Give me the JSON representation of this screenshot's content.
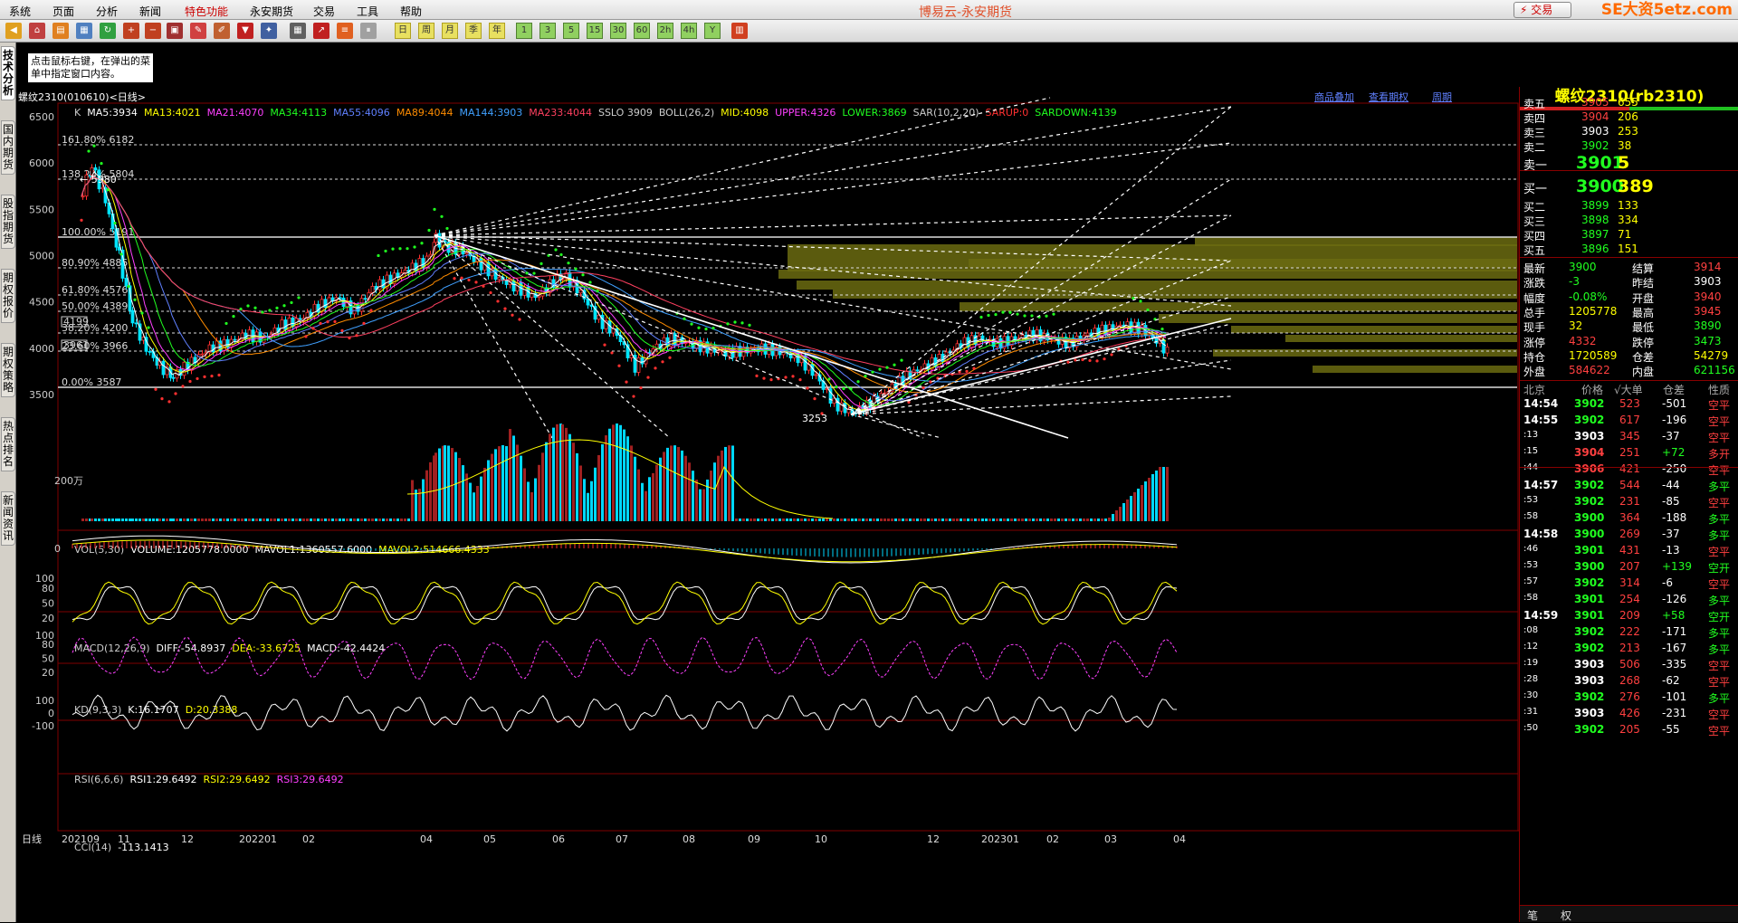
{
  "menu": {
    "items": [
      "系统",
      "页面",
      "分析",
      "新闻",
      "特色功能",
      "永安期货",
      "交易",
      "工具",
      "帮助"
    ],
    "app_title": "博易云-永安期货",
    "trade_button": "⚡ 交易",
    "watermark": "SE大资5etz.com"
  },
  "toolbar": {
    "period_buttons": [
      "日",
      "周",
      "月",
      "季",
      "年",
      "1",
      "3",
      "5",
      "15",
      "30",
      "60",
      "2h",
      "4h",
      "Y"
    ]
  },
  "left_tabs": [
    "技术分析",
    "国内期货",
    "股指期货",
    "期权报价",
    "期权策略",
    "热点排名",
    "新闻资讯"
  ],
  "tooltip": "点击鼠标右键，在弹出的菜单中指定窗口内容。",
  "chart": {
    "header": "螺纹2310(010610)<日线>",
    "links": [
      "商品叠加",
      "查看期权",
      "周期"
    ],
    "indicator_line": [
      {
        "t": "K",
        "c": "#ccc"
      },
      {
        "t": "MA5:3934",
        "c": "#fff"
      },
      {
        "t": "MA13:4021",
        "c": "#ffff00"
      },
      {
        "t": "MA21:4070",
        "c": "#ff40ff"
      },
      {
        "t": "MA34:4113",
        "c": "#20ff20"
      },
      {
        "t": "MA55:4096",
        "c": "#6080ff"
      },
      {
        "t": "MA89:4044",
        "c": "#ff8c00"
      },
      {
        "t": "MA144:3903",
        "c": "#40a0ff"
      },
      {
        "t": "MA233:4044",
        "c": "#ff4060"
      },
      {
        "t": "SSLO 3909",
        "c": "#ccc"
      },
      {
        "t": "BOLL(26,2)",
        "c": "#ccc"
      },
      {
        "t": "MID:4098",
        "c": "#ffff00"
      },
      {
        "t": "UPPER:4326",
        "c": "#ff40ff"
      },
      {
        "t": "LOWER:3869",
        "c": "#20ff20"
      },
      {
        "t": "SAR(10,2,20)",
        "c": "#ccc"
      },
      {
        "t": "SARUP:0",
        "c": "#ff3030"
      },
      {
        "t": "SARDOWN:4139",
        "c": "#20ff20"
      }
    ],
    "y_ticks": [
      "6500",
      "6000",
      "5500",
      "5000",
      "4500",
      "4000",
      "3500"
    ],
    "fib_labels": [
      "161.80% 6182",
      "138.20% 5804",
      "100.00% 5191",
      "80.90% 4885",
      "61.80% 4576",
      "50.00% 4389",
      "38.20% 4200",
      "23.60% 3966",
      "0.00% 3587"
    ],
    "price_marks": {
      "high": "5980",
      "low": "3253",
      "box1": "4199",
      "box2": "3961"
    },
    "vol_title": [
      {
        "t": "VOL(5,30)",
        "c": "#ccc"
      },
      {
        "t": "VOLUME:1205778.0000",
        "c": "#fff"
      },
      {
        "t": "MAVOL1:1360557.6000",
        "c": "#fff"
      },
      {
        "t": "MAVOL2:514666.4333",
        "c": "#ffff00"
      }
    ],
    "vol_tick": "200万",
    "macd_title": [
      {
        "t": "MACD(12,26,9)",
        "c": "#ccc"
      },
      {
        "t": "DIFF:-54.8937",
        "c": "#fff"
      },
      {
        "t": "DEA:-33.6725",
        "c": "#ffff00"
      },
      {
        "t": "MACD:-42.4424",
        "c": "#fff"
      }
    ],
    "macd_tick": "0",
    "kd_title": [
      {
        "t": "KD(9,3,3)",
        "c": "#ccc"
      },
      {
        "t": "K:16.1707",
        "c": "#fff"
      },
      {
        "t": "D:20.3388",
        "c": "#ffff00"
      }
    ],
    "kd_ticks": [
      "100",
      "80",
      "50",
      "20"
    ],
    "rsi_title": [
      {
        "t": "RSI(6,6,6)",
        "c": "#ccc"
      },
      {
        "t": "RSI1:29.6492",
        "c": "#fff"
      },
      {
        "t": "RSI2:29.6492",
        "c": "#ffff00"
      },
      {
        "t": "RSI3:29.6492",
        "c": "#ff40ff"
      }
    ],
    "rsi_ticks": [
      "100",
      "80",
      "50",
      "20"
    ],
    "cci_title": [
      {
        "t": "CCI(14)",
        "c": "#ccc"
      },
      {
        "t": "-113.1413",
        "c": "#fff"
      }
    ],
    "cci_ticks": [
      "100",
      "0",
      "-100"
    ],
    "x_labels": [
      "日线",
      "202109",
      "11",
      "12",
      "202201",
      "02",
      "04",
      "05",
      "06",
      "07",
      "08",
      "09",
      "10",
      "12",
      "202301",
      "02",
      "03",
      "04"
    ]
  },
  "quote": {
    "title": "螺纹2310(rb2310)",
    "asks": [
      {
        "label": "卖五",
        "price": "3905",
        "vol": "655",
        "pc": "red"
      },
      {
        "label": "卖四",
        "price": "3904",
        "vol": "206",
        "pc": "red"
      },
      {
        "label": "卖三",
        "price": "3903",
        "vol": "253",
        "pc": "white"
      },
      {
        "label": "卖二",
        "price": "3902",
        "vol": "38",
        "pc": "green"
      },
      {
        "label": "卖一",
        "price": "3901",
        "vol": "5",
        "pc": "green"
      }
    ],
    "bids": [
      {
        "label": "买一",
        "price": "3900",
        "vol": "389",
        "pc": "green"
      },
      {
        "label": "买二",
        "price": "3899",
        "vol": "133",
        "pc": "green"
      },
      {
        "label": "买三",
        "price": "3898",
        "vol": "334",
        "pc": "green"
      },
      {
        "label": "买四",
        "price": "3897",
        "vol": "71",
        "pc": "green"
      },
      {
        "label": "买五",
        "price": "3896",
        "vol": "151",
        "pc": "green"
      }
    ],
    "stats": [
      {
        "l1": "最新",
        "v1": "3900",
        "c1": "green",
        "l2": "结算",
        "v2": "3914",
        "c2": "red"
      },
      {
        "l1": "涨跌",
        "v1": "-3",
        "c1": "green",
        "l2": "昨结",
        "v2": "3903",
        "c2": "white"
      },
      {
        "l1": "幅度",
        "v1": "-0.08%",
        "c1": "green",
        "l2": "开盘",
        "v2": "3940",
        "c2": "red"
      },
      {
        "l1": "总手",
        "v1": "1205778",
        "c1": "yellow",
        "l2": "最高",
        "v2": "3945",
        "c2": "red"
      },
      {
        "l1": "现手",
        "v1": "32",
        "c1": "yellow",
        "l2": "最低",
        "v2": "3890",
        "c2": "green"
      },
      {
        "l1": "涨停",
        "v1": "4332",
        "c1": "red",
        "l2": "跌停",
        "v2": "3473",
        "c2": "green"
      },
      {
        "l1": "持仓",
        "v1": "1720589",
        "c1": "yellow",
        "l2": "仓差",
        "v2": "54279",
        "c2": "yellow"
      },
      {
        "l1": "外盘",
        "v1": "584622",
        "c1": "red",
        "l2": "内盘",
        "v2": "621156",
        "c2": "green"
      }
    ],
    "tick_header": [
      "北京",
      "价格",
      "√大单",
      "仓差",
      "性质"
    ],
    "ticks": [
      {
        "t": "14:54",
        "p": "3902",
        "pc": "green",
        "v": "523",
        "c": "-501",
        "n": "空平",
        "nc": "red",
        "big": true
      },
      {
        "t": "14:55",
        "p": "3902",
        "pc": "green",
        "v": "617",
        "c": "-196",
        "n": "空平",
        "nc": "red",
        "big": true
      },
      {
        "t": ":13",
        "p": "3903",
        "pc": "white",
        "v": "345",
        "c": "-37",
        "n": "空平",
        "nc": "red",
        "big": false
      },
      {
        "t": ":15",
        "p": "3904",
        "pc": "red",
        "v": "251",
        "c": "+72",
        "n": "多开",
        "nc": "red",
        "big": false
      },
      {
        "t": ":44",
        "p": "3906",
        "pc": "red",
        "v": "421",
        "c": "-250",
        "n": "空平",
        "nc": "red",
        "big": false
      },
      {
        "t": "14:57",
        "p": "3902",
        "pc": "green",
        "v": "544",
        "c": "-44",
        "n": "多平",
        "nc": "green",
        "big": true
      },
      {
        "t": ":53",
        "p": "3902",
        "pc": "green",
        "v": "231",
        "c": "-85",
        "n": "空平",
        "nc": "red",
        "big": false
      },
      {
        "t": ":58",
        "p": "3900",
        "pc": "green",
        "v": "364",
        "c": "-188",
        "n": "多平",
        "nc": "green",
        "big": false
      },
      {
        "t": "14:58",
        "p": "3900",
        "pc": "green",
        "v": "269",
        "c": "-37",
        "n": "多平",
        "nc": "green",
        "big": true
      },
      {
        "t": ":46",
        "p": "3901",
        "pc": "green",
        "v": "431",
        "c": "-13",
        "n": "空平",
        "nc": "red",
        "big": false
      },
      {
        "t": ":53",
        "p": "3900",
        "pc": "green",
        "v": "207",
        "c": "+139",
        "n": "空开",
        "nc": "green",
        "big": false
      },
      {
        "t": ":57",
        "p": "3902",
        "pc": "green",
        "v": "314",
        "c": "-6",
        "n": "空平",
        "nc": "red",
        "big": false
      },
      {
        "t": ":58",
        "p": "3901",
        "pc": "green",
        "v": "254",
        "c": "-126",
        "n": "多平",
        "nc": "green",
        "big": false
      },
      {
        "t": "14:59",
        "p": "3901",
        "pc": "green",
        "v": "209",
        "c": "+58",
        "n": "空开",
        "nc": "green",
        "big": true
      },
      {
        "t": ":08",
        "p": "3902",
        "pc": "green",
        "v": "222",
        "c": "-171",
        "n": "多平",
        "nc": "green",
        "big": false
      },
      {
        "t": ":12",
        "p": "3902",
        "pc": "green",
        "v": "213",
        "c": "-167",
        "n": "多平",
        "nc": "green",
        "big": false
      },
      {
        "t": ":19",
        "p": "3903",
        "pc": "white",
        "v": "506",
        "c": "-335",
        "n": "空平",
        "nc": "red",
        "big": false
      },
      {
        "t": ":28",
        "p": "3903",
        "pc": "white",
        "v": "268",
        "c": "-62",
        "n": "空平",
        "nc": "red",
        "big": false
      },
      {
        "t": ":30",
        "p": "3902",
        "pc": "green",
        "v": "276",
        "c": "-101",
        "n": "多平",
        "nc": "green",
        "big": false
      },
      {
        "t": ":31",
        "p": "3903",
        "pc": "white",
        "v": "426",
        "c": "-231",
        "n": "空平",
        "nc": "red",
        "big": false
      },
      {
        "t": ":50",
        "p": "3902",
        "pc": "green",
        "v": "205",
        "c": "-55",
        "n": "空平",
        "nc": "red",
        "big": false
      }
    ],
    "bottom_tabs": [
      "笔",
      "权"
    ]
  },
  "colors": {
    "up": "#ff3030",
    "down": "#00e5ff",
    "grid": "#800000",
    "fibband": "#6b6b10"
  }
}
